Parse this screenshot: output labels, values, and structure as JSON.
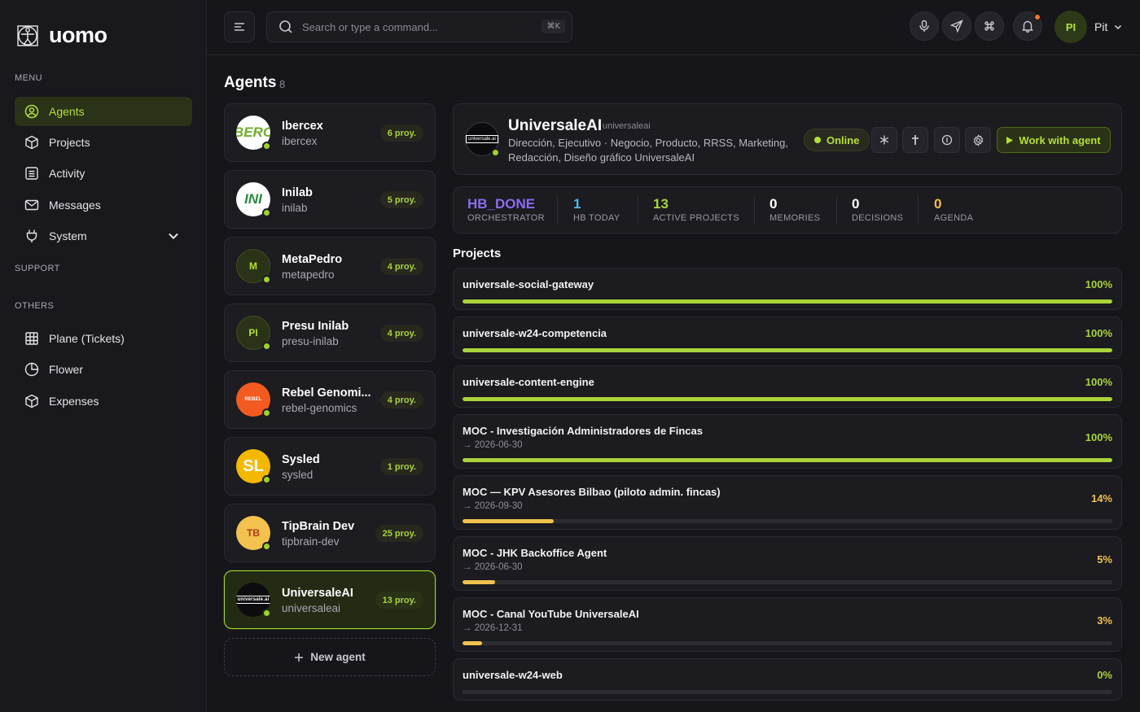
{
  "brand": {
    "name": "uomo"
  },
  "sidebar": {
    "menu_label": "MENU",
    "support_label": "SUPPORT",
    "others_label": "OTHERS",
    "menu_items": [
      {
        "label": "Agents",
        "icon": "user-circle-icon",
        "active": true
      },
      {
        "label": "Projects",
        "icon": "cube-icon"
      },
      {
        "label": "Activity",
        "icon": "list-icon"
      },
      {
        "label": "Messages",
        "icon": "mail-icon"
      },
      {
        "label": "System",
        "icon": "plug-icon"
      }
    ],
    "other_items": [
      {
        "label": "Plane (Tickets)",
        "icon": "grid-icon"
      },
      {
        "label": "Flower",
        "icon": "pie-icon"
      },
      {
        "label": "Expenses",
        "icon": "cube-icon"
      }
    ]
  },
  "topbar": {
    "search_placeholder": "Search or type a command...",
    "shortcut": "⌘K",
    "user_initials": "PI",
    "user_name": "Pit"
  },
  "agents": {
    "title": "Agents",
    "count": "8",
    "new_agent_label": "New agent",
    "items": [
      {
        "name": "Ibercex",
        "slug": "ibercex",
        "proy": "6 proy.",
        "avatar_text": "BERC",
        "avatar_bg": "#ffffff",
        "avatar_fg": "#6fae2a"
      },
      {
        "name": "Inilab",
        "slug": "inilab",
        "proy": "5 proy.",
        "avatar_text": "INI",
        "avatar_bg": "#ffffff",
        "avatar_fg": "#2b8a3e"
      },
      {
        "name": "MetaPedro",
        "slug": "metapedro",
        "proy": "4 proy.",
        "avatar_text": "M",
        "avatar_bg": "#2a3317",
        "avatar_fg": "#b5e03a"
      },
      {
        "name": "Presu Inilab",
        "slug": "presu-inilab",
        "proy": "4 proy.",
        "avatar_text": "PI",
        "avatar_bg": "#2a3317",
        "avatar_fg": "#b5e03a"
      },
      {
        "name": "Rebel Genomi...",
        "slug": "rebel-genomics",
        "proy": "4 proy.",
        "avatar_text": "REBEL",
        "avatar_bg": "#f25a1f",
        "avatar_fg": "#ffffff"
      },
      {
        "name": "Sysled",
        "slug": "sysled",
        "proy": "1 proy.",
        "avatar_text": "SL",
        "avatar_bg": "#f5b800",
        "avatar_fg": "#ffffff"
      },
      {
        "name": "TipBrain Dev",
        "slug": "tipbrain-dev",
        "proy": "25 proy.",
        "avatar_text": "TB",
        "avatar_bg": "#f2c14e",
        "avatar_fg": "#b23a1a"
      },
      {
        "name": "UniversaleAI",
        "slug": "universaleai",
        "proy": "13 proy.",
        "avatar_text": "universale.ai",
        "avatar_bg": "#0c0c0e",
        "avatar_fg": "#ffffff",
        "selected": true
      }
    ]
  },
  "detail": {
    "name": "UniversaleAI",
    "slug": "universaleai",
    "description": "Dirección, Ejecutivo · Negocio, Producto, RRSS, Marketing, Redacción, Diseño gráfico UniversaleAI",
    "avatar_text": "universale.ai",
    "status": "Online",
    "work_label": "Work with agent"
  },
  "stats": [
    {
      "value": "HB_DONE",
      "label": "ORCHESTRATOR",
      "color": "#8b6cf0"
    },
    {
      "value": "1",
      "label": "HB TODAY",
      "color": "#4fb8e8"
    },
    {
      "value": "13",
      "label": "ACTIVE PROJECTS",
      "color": "#a9d43a"
    },
    {
      "value": "0",
      "label": "MEMORIES",
      "color": "#ffffff"
    },
    {
      "value": "0",
      "label": "DECISIONS",
      "color": "#ffffff"
    },
    {
      "value": "0",
      "label": "AGENDA",
      "color": "#f2c14e"
    }
  ],
  "projects": {
    "title": "Projects",
    "items": [
      {
        "name": "universale-social-gateway",
        "date": "",
        "pct": "100%",
        "progress": 1.0,
        "color": "#a9d43a"
      },
      {
        "name": "universale-w24-competencia",
        "date": "",
        "pct": "100%",
        "progress": 1.0,
        "color": "#a9d43a"
      },
      {
        "name": "universale-content-engine",
        "date": "",
        "pct": "100%",
        "progress": 1.0,
        "color": "#a9d43a"
      },
      {
        "name": "MOC - Investigación Administradores de Fincas",
        "date": "→ 2026-06-30",
        "pct": "100%",
        "progress": 1.0,
        "color": "#a9d43a"
      },
      {
        "name": "MOC — KPV Asesores Bilbao (piloto admin. fincas)",
        "date": "→ 2026-09-30",
        "pct": "14%",
        "progress": 0.14,
        "color": "#f2c14e"
      },
      {
        "name": "MOC - JHK Backoffice Agent",
        "date": "→ 2026-06-30",
        "pct": "5%",
        "progress": 0.05,
        "color": "#f2c14e"
      },
      {
        "name": "MOC - Canal YouTube UniversaleAI",
        "date": "→ 2026-12-31",
        "pct": "3%",
        "progress": 0.03,
        "color": "#f2c14e"
      },
      {
        "name": "universale-w24-web",
        "date": "",
        "pct": "0%",
        "progress": 0.0,
        "color": "#a9d43a"
      }
    ]
  }
}
